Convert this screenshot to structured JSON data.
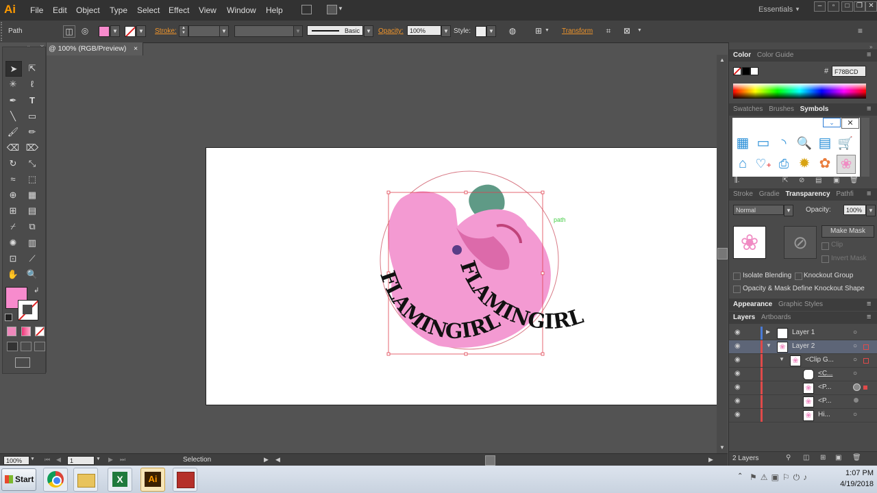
{
  "menubar": {
    "logo": "Ai",
    "items": [
      "File",
      "Edit",
      "Object",
      "Type",
      "Select",
      "Effect",
      "View",
      "Window",
      "Help"
    ],
    "workspace": "Essentials"
  },
  "controlbar": {
    "selection_label": "Path",
    "stroke_label": "Stroke:",
    "brush_style": "Basic",
    "opacity_label": "Opacity:",
    "opacity_value": "100%",
    "style_label": "Style:",
    "transform_label": "Transform"
  },
  "document": {
    "tab_title": "@ 100% (RGB/Preview)",
    "close_glyph": "×",
    "path_hint": "path",
    "artwork_text": "FLAMINGIRL"
  },
  "colors": {
    "fill": "#F78BCD",
    "accent": "#f0952b"
  },
  "color_panel": {
    "tabs": [
      "Color",
      "Color Guide"
    ],
    "hash": "#",
    "hex_value": "F78BCD"
  },
  "symbols_panel": {
    "tabs": [
      "Swatches",
      "Brushes",
      "Symbols"
    ],
    "icons": [
      "table-icon",
      "window-icon",
      "rss-icon",
      "search-icon",
      "tab-icon",
      "cart-icon",
      "home-icon",
      "heart-plus-icon",
      "printer-icon",
      "sunflower-icon",
      "gerbera-icon",
      "flamingo-icon"
    ]
  },
  "transparency_panel": {
    "tabs": [
      "Stroke",
      "Gradie",
      "Transparency",
      "Pathfi"
    ],
    "blend_mode": "Normal",
    "opacity_label": "Opacity:",
    "opacity_value": "100%",
    "make_mask": "Make Mask",
    "clip_label": "Clip",
    "invert_mask_label": "Invert Mask",
    "isolate_blending": "Isolate Blending",
    "knockout_group": "Knockout Group",
    "opacity_mask_define": "Opacity & Mask Define Knockout Shape"
  },
  "appearance_tabs": [
    "Appearance",
    "Graphic Styles"
  ],
  "layers_panel": {
    "tabs": [
      "Layers",
      "Artboards"
    ],
    "rows": [
      {
        "name": "Layer 1"
      },
      {
        "name": "Layer 2"
      },
      {
        "name": "<Clip G..."
      },
      {
        "name": "<C..."
      },
      {
        "name": "<P..."
      },
      {
        "name": "<P..."
      },
      {
        "name": "Hi..."
      }
    ],
    "footer_count": "2 Layers"
  },
  "statusbar": {
    "zoom": "100%",
    "artboard_num": "1",
    "tool_name": "Selection"
  },
  "taskbar": {
    "start_label": "Start",
    "time": "1:07 PM",
    "date": "4/19/2018",
    "app_ai_label": "Ai"
  }
}
